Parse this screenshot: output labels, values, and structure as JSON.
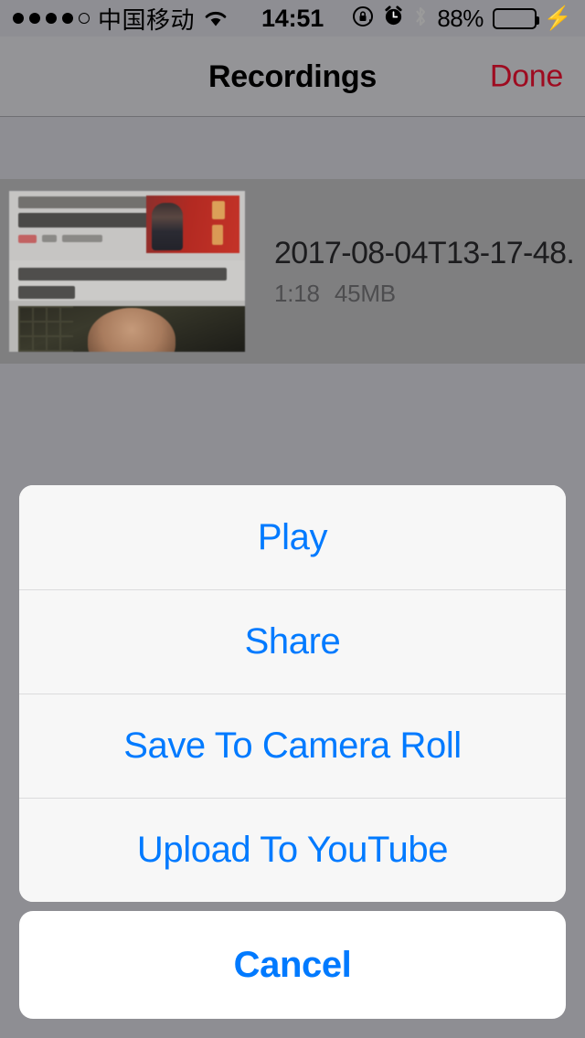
{
  "status_bar": {
    "signal_dots_filled": 4,
    "signal_dots_total": 5,
    "carrier": "中国移动",
    "wifi_icon": "wifi-icon",
    "time": "14:51",
    "rotation_lock_icon": "rotation-lock-icon",
    "alarm_icon": "alarm-clock-icon",
    "bluetooth_icon": "bluetooth-icon",
    "battery_percent": "88%",
    "battery_level": 88,
    "battery_color": "#22a63a",
    "charging_icon": "charging-bolt-icon"
  },
  "nav_bar": {
    "title": "Recordings",
    "done_label": "Done",
    "done_color": "#9e0b20"
  },
  "list": {
    "rows": [
      {
        "thumbnail": "video-thumbnail",
        "title": "2017-08-04T13-17-48....",
        "duration": "1:18",
        "size": "45MB"
      }
    ]
  },
  "action_sheet": {
    "accent_color": "#007aff",
    "buttons": [
      {
        "label": "Play"
      },
      {
        "label": "Share"
      },
      {
        "label": "Save To Camera Roll"
      },
      {
        "label": "Upload To YouTube"
      }
    ],
    "cancel_label": "Cancel"
  }
}
